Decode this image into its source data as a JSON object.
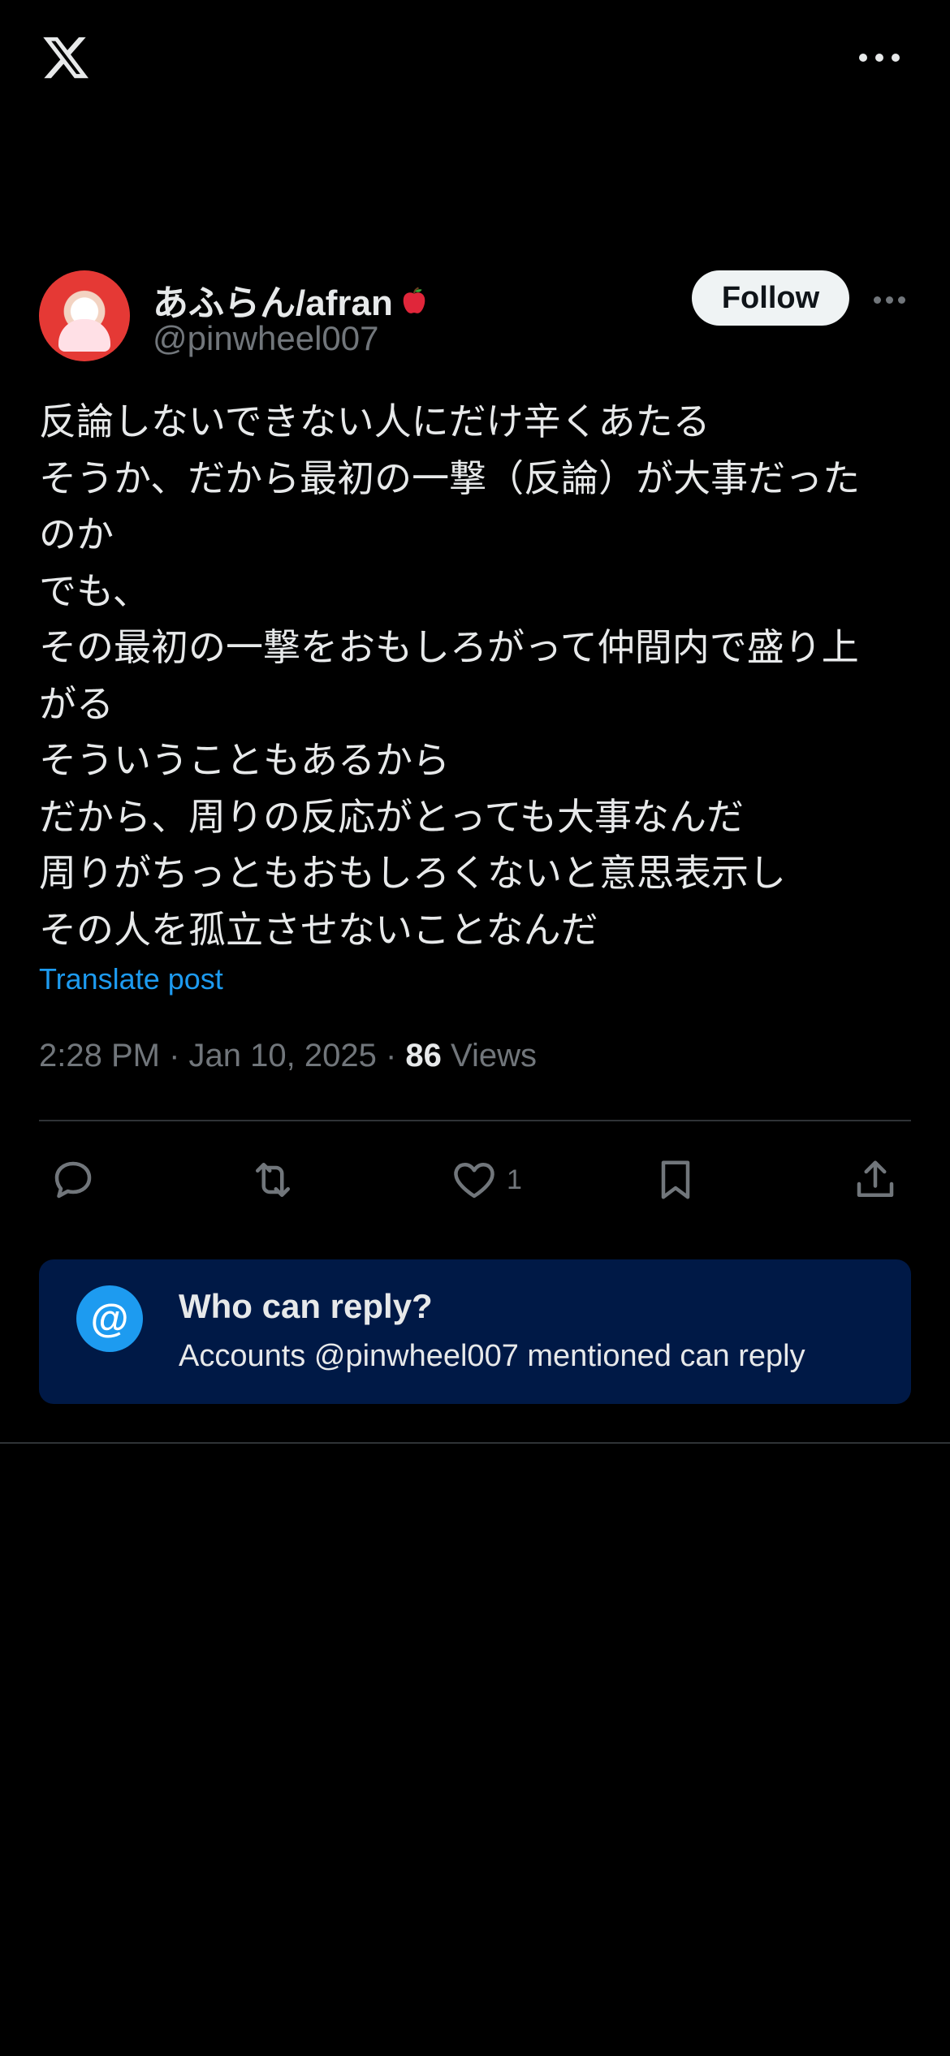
{
  "header": {
    "logo_icon": "x-logo-icon",
    "more_icon": "more-horizontal-icon"
  },
  "author": {
    "display_name": "あふらん/afran",
    "emoji_icon": "red-apple-icon",
    "handle": "@pinwheel007",
    "follow_label": "Follow"
  },
  "post": {
    "text": "反論しないできない人にだけ辛くあたる\nそうか、だから最初の一撃（反論）が大事だった\nのか\nでも、\nその最初の一撃をおもしろがって仲間内で盛り上\nがる\nそういうこともあるから\nだから、周りの反応がとっても大事なんだ\n周りがちっともおもしろくないと意思表示し\nその人を孤立させないことなんだ",
    "translate_label": "Translate post",
    "time": "2:28 PM",
    "date": "Jan 10, 2025",
    "views_count": "86",
    "views_label": "Views"
  },
  "actions": {
    "reply_icon": "reply-icon",
    "repost_icon": "repost-icon",
    "like_icon": "heart-icon",
    "like_count": "1",
    "bookmark_icon": "bookmark-icon",
    "share_icon": "share-icon"
  },
  "reply_restriction": {
    "icon": "at-icon",
    "icon_glyph": "@",
    "title": "Who can reply?",
    "subtitle": "Accounts @pinwheel007 mentioned can reply"
  },
  "colors": {
    "accent": "#1d9bf0",
    "background": "#000000",
    "card": "#001946",
    "muted": "#71767b"
  }
}
